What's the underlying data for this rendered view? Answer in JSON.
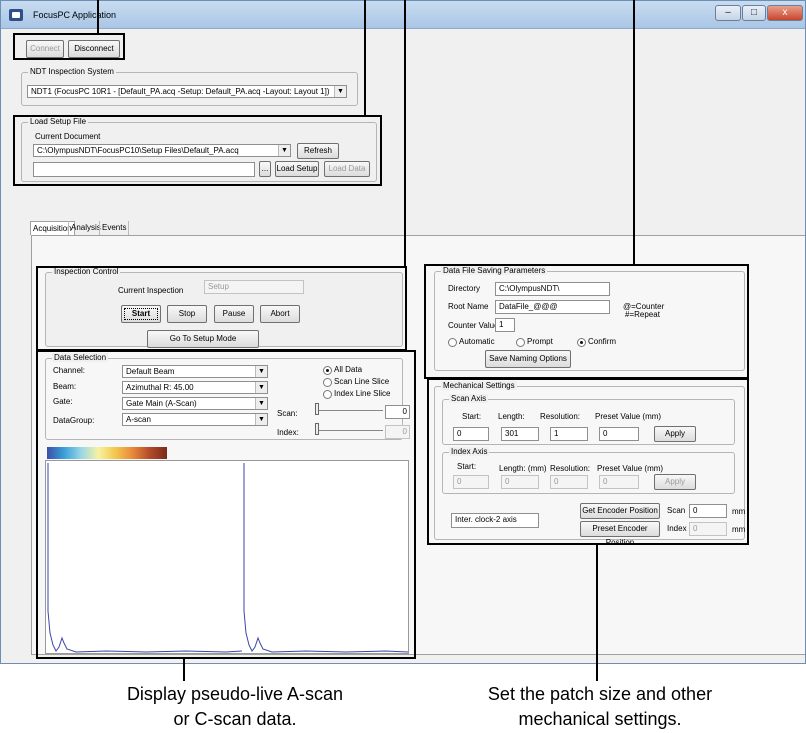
{
  "window": {
    "title": "FocusPC Application",
    "minimize": "–",
    "maximize": "□",
    "close": "x"
  },
  "connection": {
    "connect": "Connect",
    "disconnect": "Disconnect"
  },
  "ndt": {
    "group_label": "NDT Inspection System",
    "selected": "NDT1 (FocusPC 10R1 - [Default_PA.acq -Setup: Default_PA.acq -Layout: Layout 1])"
  },
  "load_setup": {
    "group_label": "Load Setup File",
    "current_doc_label": "Current Document",
    "current_doc": "C:\\OlympusNDT\\FocusPC10\\Setup Files\\Default_PA.acq",
    "refresh": "Refresh",
    "browse": "...",
    "load_setup": "Load Setup",
    "load_data": "Load Data",
    "file_field": ""
  },
  "tabs": [
    "Acquisition",
    "Analysis",
    "Events"
  ],
  "inspection_control": {
    "group_label": "Inspection Control",
    "current_label": "Current Inspection",
    "current_value": "Setup",
    "start": "Start",
    "stop": "Stop",
    "pause": "Pause",
    "abort": "Abort",
    "setup_mode": "Go To Setup Mode"
  },
  "data_selection": {
    "group_label": "Data Selection",
    "channel_label": "Channel:",
    "channel": "Default Beam",
    "beam_label": "Beam:",
    "beam": "Azimuthal  R: 45.00",
    "gate_label": "Gate:",
    "gate": "Gate Main (A-Scan)",
    "datagroup_label": "DataGroup:",
    "datagroup": "A-scan",
    "all_data": "All Data",
    "scan_slice": "Scan Line Slice",
    "index_slice": "Index Line Slice",
    "scan_label": "Scan:",
    "scan_value": "0",
    "index_label": "Index:",
    "index_value": "0"
  },
  "data_file": {
    "group_label": "Data File Saving Parameters",
    "directory_label": "Directory",
    "directory": "C:\\OlympusNDT\\",
    "root_label": "Root Name",
    "root": "DataFile_@@@",
    "counter_hint": "@=Counter",
    "repeat_hint": "#=Repeat",
    "counter_label": "Counter Value",
    "counter": "1",
    "automatic": "Automatic",
    "prompt": "Prompt",
    "confirm": "Confirm",
    "save_naming": "Save Naming Options"
  },
  "mechanical": {
    "group_label": "Mechanical Settings",
    "scan_axis": "Scan Axis",
    "start_label": "Start:",
    "length_label": "Length:",
    "resolution_label": "Resolution:",
    "preset_label": "Preset Value (mm)",
    "scan_start": "0",
    "scan_length": "301",
    "scan_resolution": "1",
    "scan_preset": "0",
    "apply": "Apply",
    "index_axis": "Index Axis",
    "index_start_label": "Start:",
    "index_length_label": "Length: (mm)",
    "index_resolution_label": "Resolution:",
    "index_preset_label": "Preset Value (mm)",
    "index_start": "0",
    "index_length": "0",
    "index_resolution": "0",
    "index_preset": "0",
    "encoder_type": "Inter. clock-2 axis",
    "get_encoder": "Get Encoder Position",
    "preset_encoder": "Preset Encoder Position",
    "scan_pos_label": "Scan",
    "scan_pos": "0",
    "index_pos_label": "Index",
    "index_pos": "0",
    "mm": "mm"
  },
  "captions": {
    "left": "Display pseudo-live A-scan or C-scan data.",
    "right": "Set the patch size and other mechanical settings."
  }
}
